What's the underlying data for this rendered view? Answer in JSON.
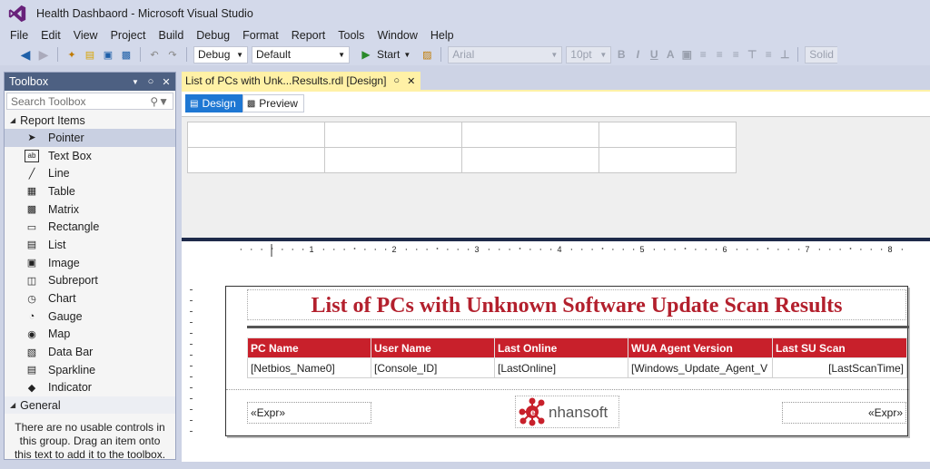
{
  "window": {
    "title": "Health Dashbaord - Microsoft Visual Studio"
  },
  "menu": [
    "File",
    "Edit",
    "View",
    "Project",
    "Build",
    "Debug",
    "Format",
    "Report",
    "Tools",
    "Window",
    "Help"
  ],
  "toolbar": {
    "config": "Debug",
    "platform": "Default",
    "start_label": "Start",
    "font": "Arial",
    "font_size": "10pt",
    "border_style": "Solid"
  },
  "toolbox": {
    "title": "Toolbox",
    "search_placeholder": "Search Toolbox",
    "group_report": "Report Items",
    "items": [
      {
        "label": "Pointer",
        "icon": "pointer-icon"
      },
      {
        "label": "Text Box",
        "icon": "textbox-icon"
      },
      {
        "label": "Line",
        "icon": "line-icon"
      },
      {
        "label": "Table",
        "icon": "table-icon"
      },
      {
        "label": "Matrix",
        "icon": "matrix-icon"
      },
      {
        "label": "Rectangle",
        "icon": "rectangle-icon"
      },
      {
        "label": "List",
        "icon": "list-icon"
      },
      {
        "label": "Image",
        "icon": "image-icon"
      },
      {
        "label": "Subreport",
        "icon": "subreport-icon"
      },
      {
        "label": "Chart",
        "icon": "chart-icon"
      },
      {
        "label": "Gauge",
        "icon": "gauge-icon"
      },
      {
        "label": "Map",
        "icon": "map-icon"
      },
      {
        "label": "Data Bar",
        "icon": "databar-icon"
      },
      {
        "label": "Sparkline",
        "icon": "sparkline-icon"
      },
      {
        "label": "Indicator",
        "icon": "indicator-icon"
      }
    ],
    "group_general": "General",
    "empty_message": "There are no usable controls in this group. Drag an item onto this text to add it to the toolbox."
  },
  "document": {
    "tab_label": "List of PCs with Unk...Results.rdl [Design]",
    "tab_design": "Design",
    "tab_preview": "Preview"
  },
  "ruler": [
    "1",
    "2",
    "3",
    "4",
    "5",
    "6",
    "7",
    "8"
  ],
  "report": {
    "title": "List of PCs with Unknown Software Update Scan Results",
    "columns": [
      "PC Name",
      "User Name",
      "Last Online",
      "WUA Agent Version",
      "Last SU Scan"
    ],
    "row": [
      "[Netbios_Name0]",
      "[Console_ID]",
      "[LastOnline]",
      "[Windows_Update_Agent_V",
      "[LastScanTime]"
    ],
    "footer_left": "«Expr»",
    "footer_right": "«Expr»",
    "logo_text": "nhansoft"
  },
  "colors": {
    "accent": "#1e77d3",
    "report_header": "#c8202b",
    "title": "#b3202d",
    "doc_tab": "#fff1a6"
  }
}
